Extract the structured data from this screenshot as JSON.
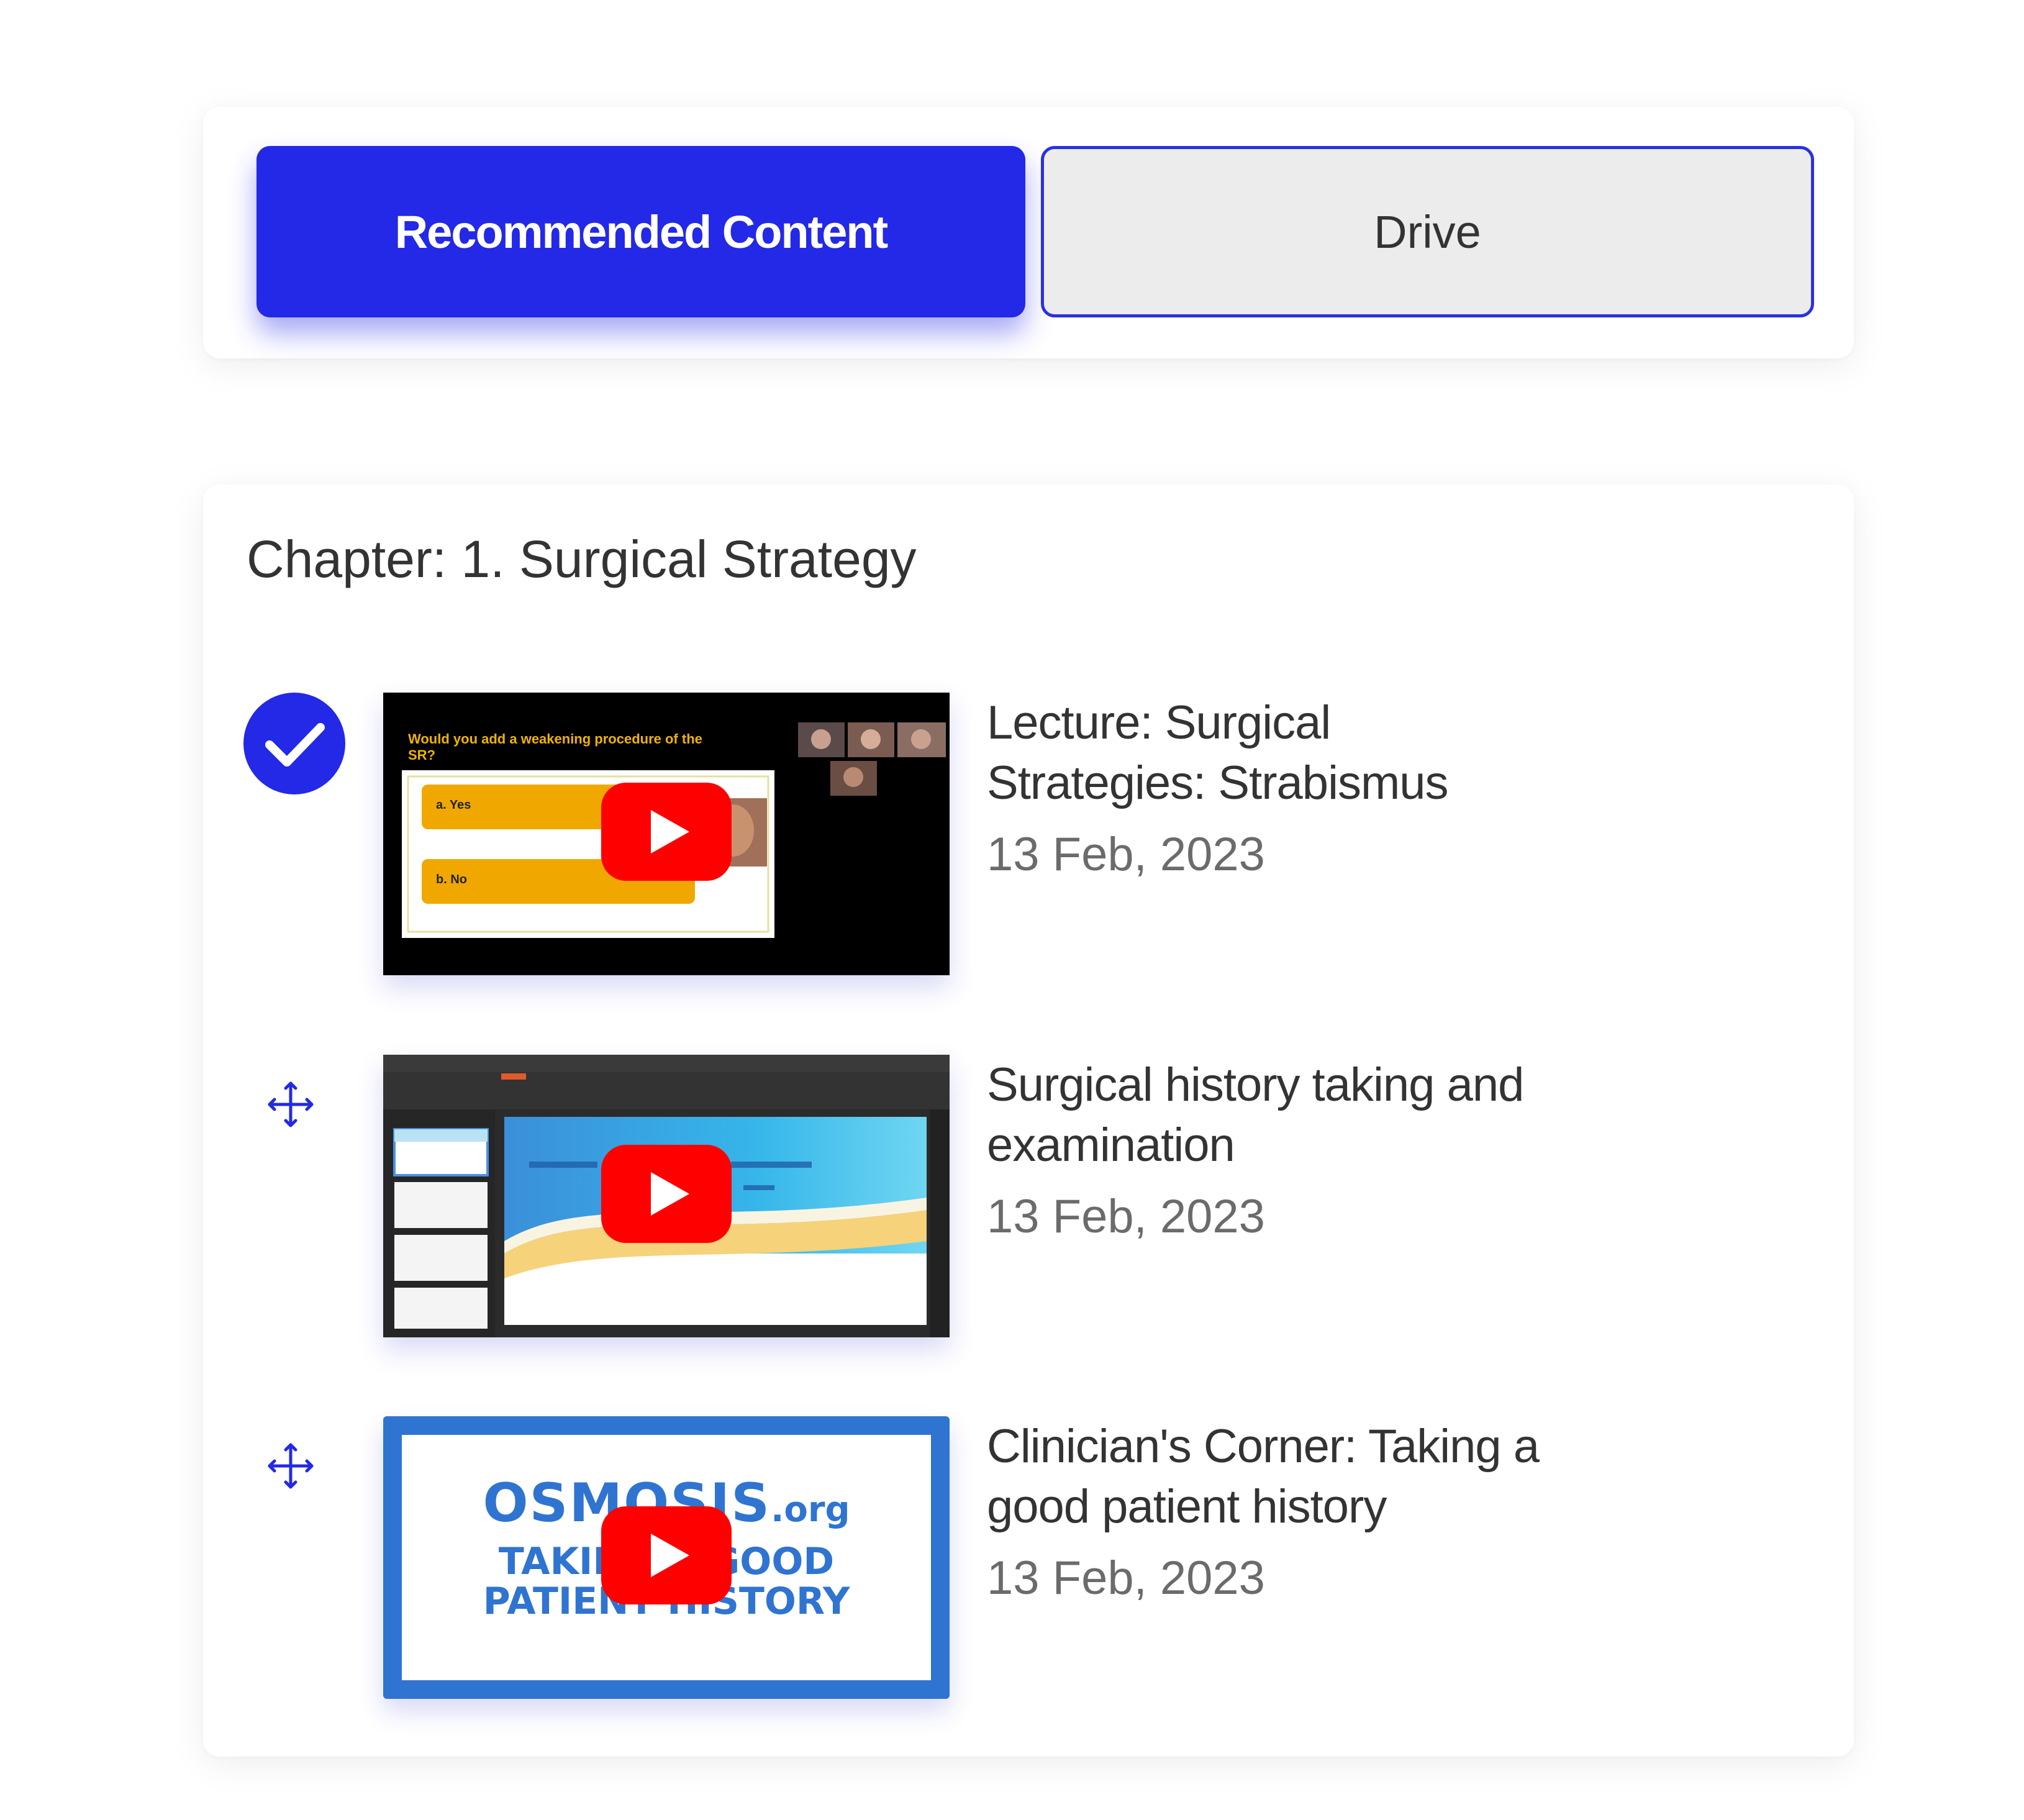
{
  "tabs": {
    "recommended_label": "Recommended Content",
    "drive_label": "Drive",
    "active": "Recommended Content"
  },
  "chapter": {
    "title": "Chapter: 1. Surgical Strategy"
  },
  "items": [
    {
      "title_line1": "Lecture: Surgical",
      "title_line2": "Strategies: Strabismus",
      "date": "13 Feb, 2023",
      "status_icon": "check-circle-icon",
      "thumbnail": {
        "question": "Would you add a weakening procedure of the",
        "question_cont": "SR?",
        "option_a": "a.  Yes",
        "option_b": "b.  No"
      }
    },
    {
      "title_line1": "Surgical history taking and",
      "title_line2": "examination",
      "date": "13 Feb, 2023",
      "status_icon": "move-icon"
    },
    {
      "title_line1": "Clinician's Corner: Taking a",
      "title_line2": "good patient history",
      "date": "13 Feb, 2023",
      "status_icon": "move-icon",
      "thumbnail": {
        "brand": "OSMOSIS",
        "brand_suffix": ".org",
        "line1": "TAKING A GOOD",
        "line2": "PATIENT HISTORY"
      }
    }
  ],
  "colors": {
    "accent": "#2329e6",
    "play_red": "#ff0000",
    "osmosis_blue": "#2f74d0",
    "date_gray": "#6b6b6b"
  }
}
